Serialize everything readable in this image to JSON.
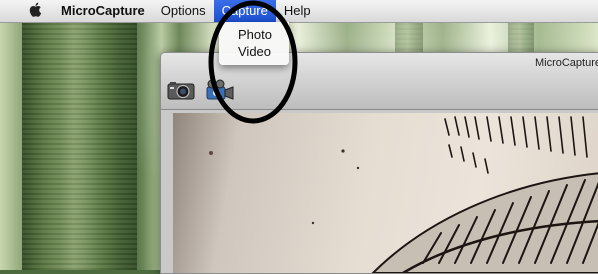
{
  "menubar": {
    "apple_icon": "apple-icon",
    "app_name": "MicroCapture",
    "items": [
      "Options",
      "Capture",
      "Help"
    ],
    "active_item": "Capture"
  },
  "capture_menu": {
    "items": [
      "Photo",
      "Video"
    ]
  },
  "window": {
    "title": "MicroCapture",
    "toolbar": {
      "photo_icon": "camera-icon",
      "video_icon": "video-camera-icon"
    }
  },
  "colors": {
    "menu_highlight": "#2a5fe0",
    "callout": "#000000"
  }
}
